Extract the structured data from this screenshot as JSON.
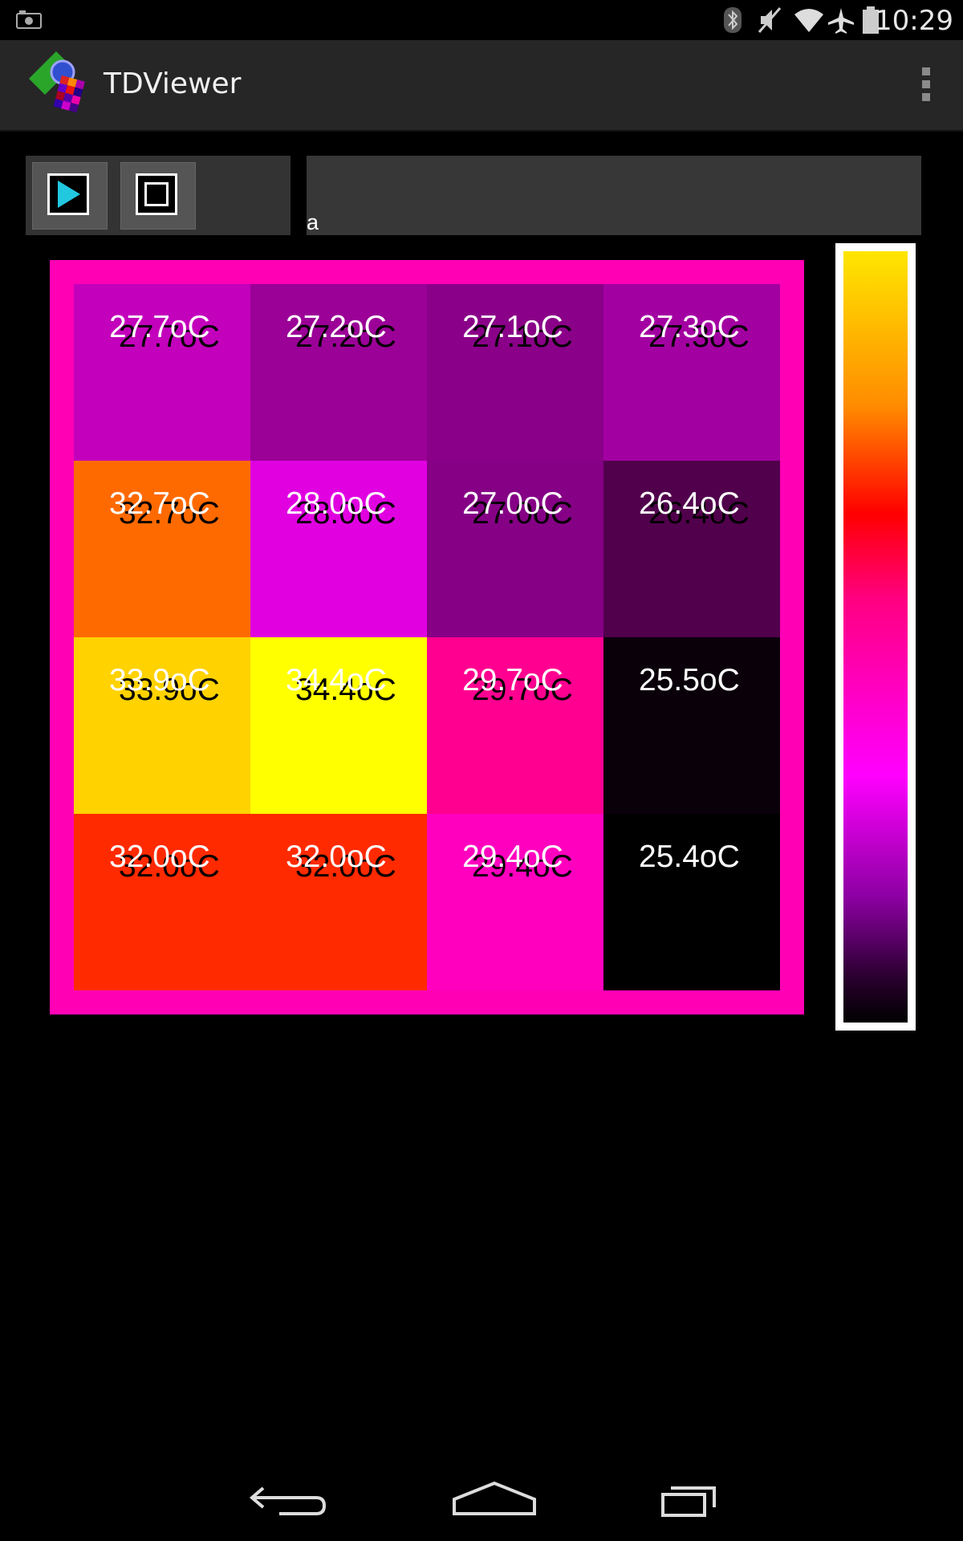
{
  "status_bar": {
    "time": "10:29"
  },
  "app": {
    "title": "TDViewer"
  },
  "controls": {
    "status_text": "a"
  },
  "colors": {
    "heatmap_frame": "#ff00b4",
    "action_bar": "#262626"
  },
  "heatmap": {
    "rows": [
      [
        {
          "value": "27.7oC",
          "shadow": "27.7oC",
          "color": "#c300bb"
        },
        {
          "value": "27.2oC",
          "shadow": "27.2oC",
          "color": "#9b0097"
        },
        {
          "value": "27.1oC",
          "shadow": "27.1oC",
          "color": "#8a0088"
        },
        {
          "value": "27.3oC",
          "shadow": "27.3oC",
          "color": "#a300a2"
        }
      ],
      [
        {
          "value": "32.7oC",
          "shadow": "32.7oC",
          "color": "#ff6a00"
        },
        {
          "value": "28.0oC",
          "shadow": "28.0oC",
          "color": "#e000e0"
        },
        {
          "value": "27.0oC",
          "shadow": "27.0oC",
          "color": "#850085"
        },
        {
          "value": "26.4oC",
          "shadow": "26.4oC",
          "color": "#51004c"
        }
      ],
      [
        {
          "value": "33.9oC",
          "shadow": "33.9oC",
          "color": "#ffd200"
        },
        {
          "value": "34.4oC",
          "shadow": "34.4oC",
          "color": "#ffff00"
        },
        {
          "value": "29.7oC",
          "shadow": "29.7oC",
          "color": "#ff0090"
        },
        {
          "value": "25.5oC",
          "shadow": "",
          "color": "#0a000a"
        }
      ],
      [
        {
          "value": "32.0oC",
          "shadow": "32.0oC",
          "color": "#ff2a00"
        },
        {
          "value": "32.0oC",
          "shadow": "32.0oC",
          "color": "#ff2a00"
        },
        {
          "value": "29.4oC",
          "shadow": "29.4oC",
          "color": "#ff00bf"
        },
        {
          "value": "25.4oC",
          "shadow": "",
          "color": "#000000"
        }
      ]
    ]
  }
}
